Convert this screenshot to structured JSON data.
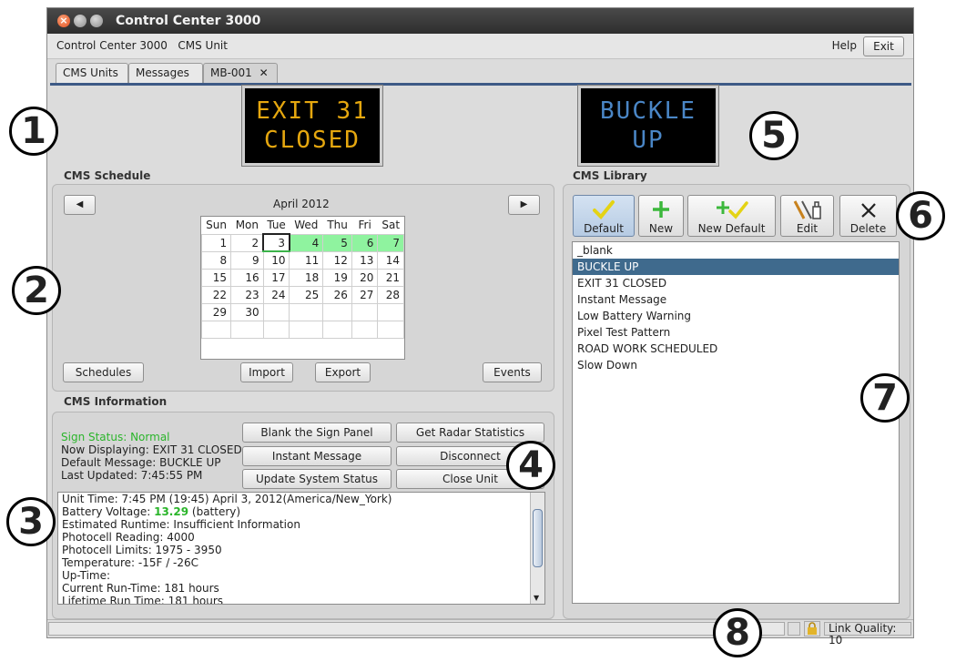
{
  "window": {
    "title": "Control Center 3000",
    "menu_app": "Control Center 3000   CMS Unit",
    "help_label": "Help",
    "exit_label": "Exit"
  },
  "tabs": [
    "CMS Units",
    "Messages",
    "MB-001"
  ],
  "tab_close_glyph": "✕",
  "signs": {
    "current": {
      "line1": "EXIT 31",
      "line2": "CLOSED",
      "color": "#e5a70f"
    },
    "default": {
      "line1": "BUCKLE",
      "line2": "UP",
      "color": "#4a86c6"
    }
  },
  "schedule": {
    "section_title": "CMS Schedule",
    "month": "April 2012",
    "prev_glyph": "◀",
    "next_glyph": "▶",
    "weekdays": [
      "Sun",
      "Mon",
      "Tue",
      "Wed",
      "Thu",
      "Fri",
      "Sat"
    ],
    "weeks": [
      [
        "1",
        "2",
        "3",
        "4",
        "5",
        "6",
        "7"
      ],
      [
        "8",
        "9",
        "10",
        "11",
        "12",
        "13",
        "14"
      ],
      [
        "15",
        "16",
        "17",
        "18",
        "19",
        "20",
        "21"
      ],
      [
        "22",
        "23",
        "24",
        "25",
        "26",
        "27",
        "28"
      ],
      [
        "29",
        "30",
        "",
        "",
        "",
        "",
        ""
      ],
      [
        "",
        "",
        "",
        "",
        "",
        "",
        ""
      ]
    ],
    "highlighted_days": [
      "4",
      "5",
      "6",
      "7"
    ],
    "today": "3",
    "buttons": {
      "schedules": "Schedules",
      "import": "Import",
      "export": "Export",
      "events": "Events"
    }
  },
  "info": {
    "section_title": "CMS Information",
    "sign_status": "Sign Status: Normal",
    "now_displaying": "Now Displaying: EXIT 31 CLOSED",
    "default_message": "Default Message: BUCKLE UP",
    "last_updated": "Last Updated: 7:45:55 PM",
    "buttons": {
      "blank": "Blank the Sign Panel",
      "radar": "Get Radar Statistics",
      "instant": "Instant Message",
      "disconnect": "Disconnect",
      "update": "Update System Status",
      "close": "Close Unit"
    },
    "details": {
      "line1": "Unit Time: 7:45 PM (19:45) April 3, 2012(America/New_York)",
      "battery_prefix": "Battery Voltage: ",
      "battery_value": "13.29",
      "battery_suffix": " (battery)",
      "line3": "Estimated Runtime: Insufficient Information",
      "line4": "Photocell Reading: 4000",
      "line5": "Photocell Limits: 1975 - 3950",
      "line6": "Temperature: -15F / -26C",
      "line7": "Up-Time:",
      "line8": "Current Run-Time: 181 hours",
      "line9": "Lifetime Run Time: 181 hours"
    }
  },
  "library": {
    "section_title": "CMS Library",
    "buttons": {
      "default": "Default",
      "new": "New",
      "new_default": "New Default",
      "edit": "Edit",
      "delete": "Delete"
    },
    "items": [
      "_blank",
      "BUCKLE UP",
      "EXIT 31 CLOSED",
      "Instant Message",
      "Low Battery Warning",
      "Pixel Test Pattern",
      "ROAD WORK SCHEDULED",
      "Slow Down"
    ],
    "selected_index": 1
  },
  "status": {
    "link_quality": "Link Quality: 10"
  },
  "callouts": [
    "1",
    "2",
    "3",
    "4",
    "5",
    "6",
    "7",
    "8"
  ],
  "colors": {
    "accent": "#3f6a8d",
    "calendar_highlight": "#8ff39f",
    "status_ok": "#2bb52b"
  },
  "icons": {
    "default": "checkmark-icon",
    "new": "plus-icon",
    "new_default": "plus-check-icon",
    "edit": "edit-tools-icon",
    "delete": "delete-icon",
    "lock": "lock-icon"
  }
}
